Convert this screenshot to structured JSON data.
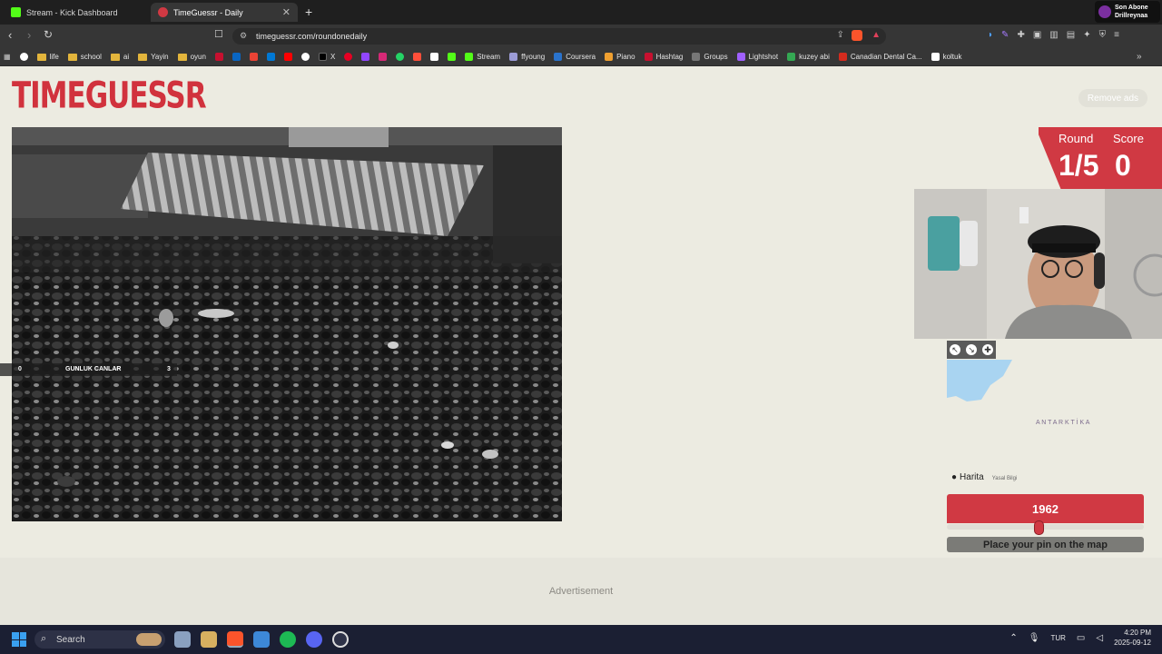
{
  "browser": {
    "tabs": [
      {
        "label": "Stream - Kick Dashboard",
        "active": false
      },
      {
        "label": "TimeGuessr - Daily",
        "active": true
      }
    ],
    "new_tab": "+",
    "url": "timeguessr.com/roundonedaily",
    "notification": {
      "line1": "Son Abone",
      "line2": "Drillreynaa"
    },
    "bookmarks": [
      "life",
      "school",
      "ai",
      "Yayin",
      "oyun",
      "X",
      "Stream",
      "ffyoung",
      "Coursera",
      "Piano",
      "Hashtag",
      "Groups",
      "Lightshot",
      "kuzey abi",
      "Canadian Dental Ca...",
      "koltuk"
    ]
  },
  "site": {
    "logo": "TIMEGUESSR",
    "remove_ads": "Remove ads",
    "round_label": "Round",
    "round_value": "1/5",
    "score_label": "Score",
    "score_value": "0",
    "overlay_left": "0",
    "overlay_center": "GUNLUK CANLAR",
    "overlay_right": "3",
    "map_label": "A N T A R K T İ K A",
    "map_brand": "Harita",
    "map_legal": "Yasal Bilgi",
    "year": "1962",
    "year_fraction": 0.47,
    "pin_button": "Place your pin on the map",
    "advertisement": "Advertisement"
  },
  "taskbar": {
    "search": "Search",
    "lang": "TUR",
    "time": "4:20 PM",
    "date": "2025-09-12"
  },
  "colors": {
    "accent": "#d03943",
    "page_bg": "#ecebe1",
    "map_water": "#a9d4f1"
  }
}
